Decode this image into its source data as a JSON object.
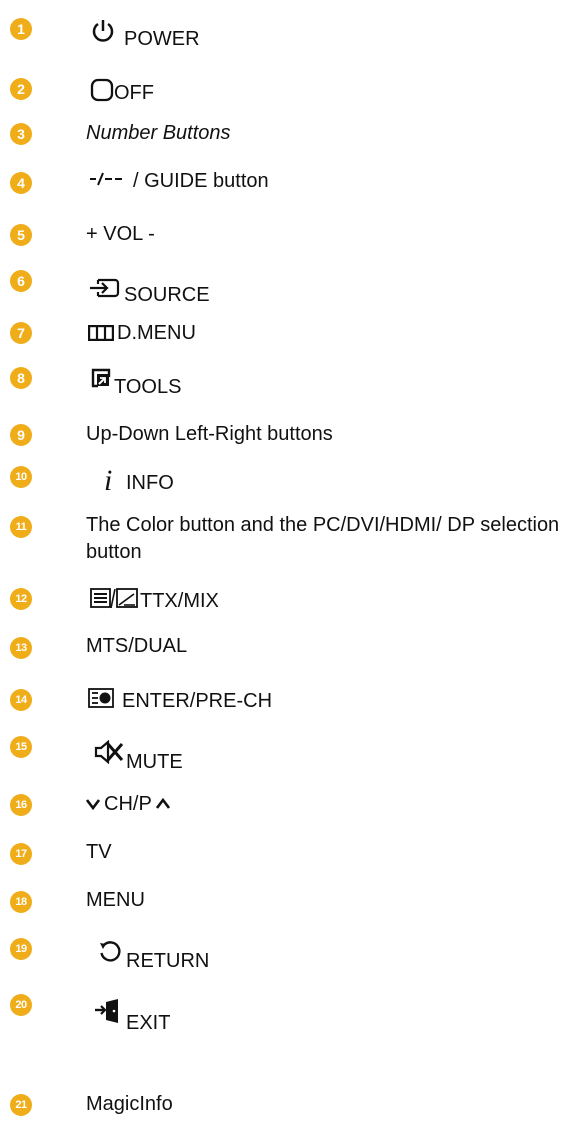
{
  "badge_color": "#f0ad1a",
  "items": [
    {
      "num": "1",
      "label": "POWER",
      "icon": "power-icon"
    },
    {
      "num": "2",
      "label": "OFF",
      "icon": "off-icon"
    },
    {
      "num": "3",
      "label": "Number Buttons",
      "icon": ""
    },
    {
      "num": "4",
      "label": "/ GUIDE button",
      "icon": "prech-dash-icon"
    },
    {
      "num": "5",
      "label": "+ VOL -",
      "icon": ""
    },
    {
      "num": "6",
      "label": "SOURCE",
      "icon": "source-icon"
    },
    {
      "num": "7",
      "label": "D.MENU",
      "icon": "dmenu-icon"
    },
    {
      "num": "8",
      "label": "TOOLS",
      "icon": "tools-icon"
    },
    {
      "num": "9",
      "label": "Up-Down Left-Right buttons",
      "icon": ""
    },
    {
      "num": "10",
      "label": "INFO",
      "icon": "info-icon"
    },
    {
      "num": "11",
      "label": "The Color button and the PC/DVI/HDMI/ DP selection button",
      "icon": ""
    },
    {
      "num": "12",
      "label": "TTX/MIX",
      "icon": "ttx-mix-icon"
    },
    {
      "num": "13",
      "label": "MTS/DUAL",
      "icon": ""
    },
    {
      "num": "14",
      "label": "ENTER/PRE-CH",
      "icon": "enter-icon"
    },
    {
      "num": "15",
      "label": "MUTE",
      "icon": "mute-icon"
    },
    {
      "num": "16",
      "label": "CH/P",
      "icon": "chevron-down-up-icon"
    },
    {
      "num": "17",
      "label": "TV",
      "icon": ""
    },
    {
      "num": "18",
      "label": "MENU",
      "icon": ""
    },
    {
      "num": "19",
      "label": "RETURN",
      "icon": "return-icon"
    },
    {
      "num": "20",
      "label": "EXIT",
      "icon": "exit-icon"
    },
    {
      "num": "21",
      "label": "MagicInfo",
      "icon": ""
    }
  ]
}
